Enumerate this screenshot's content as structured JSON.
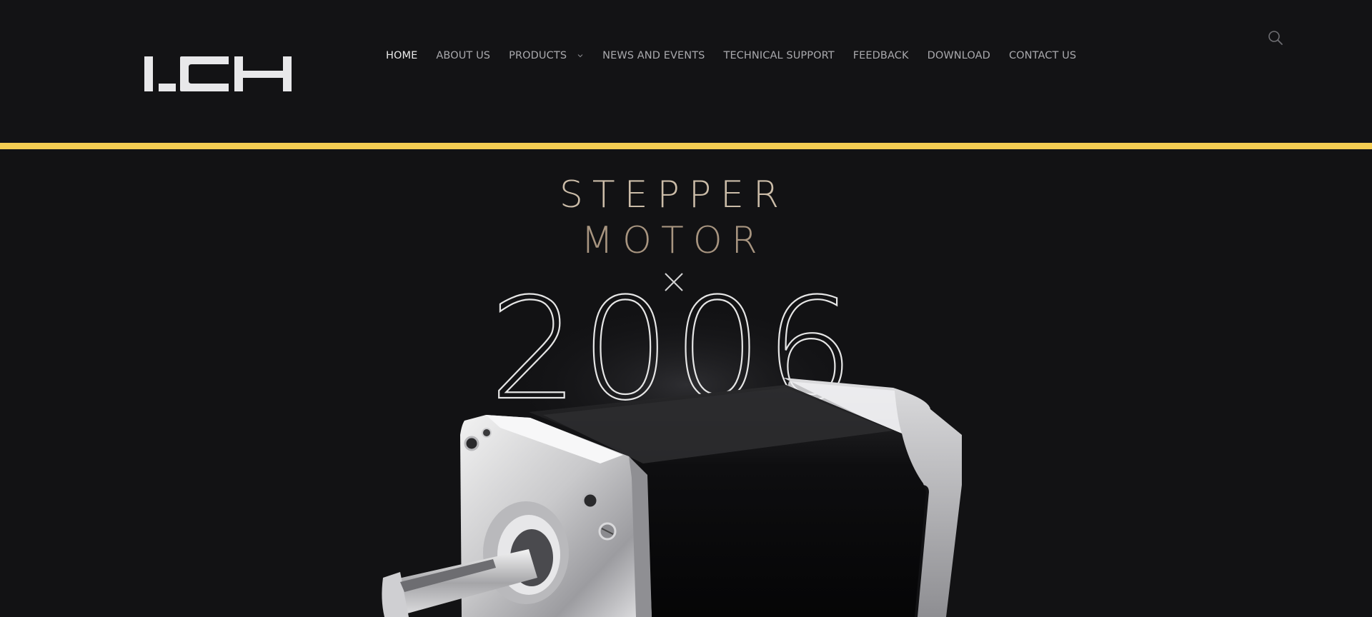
{
  "brand": {
    "logo_text": "I.CH"
  },
  "nav": {
    "items": [
      {
        "label": "HOME",
        "active": true
      },
      {
        "label": "ABOUT US"
      },
      {
        "label": "PRODUCTS",
        "has_dropdown": true
      },
      {
        "label": "NEWS AND EVENTS"
      },
      {
        "label": "TECHNICAL SUPPORT"
      },
      {
        "label": "FEEDBACK"
      },
      {
        "label": "DOWNLOAD"
      },
      {
        "label": "CONTACT US"
      }
    ],
    "dropdown_icon": "chevron-down-icon",
    "search_icon": "search-icon"
  },
  "hero": {
    "line1": "STEPPER",
    "line2": "MOTOR",
    "separator_icon": "close-icon",
    "year": "2006",
    "image": "stepper-motor-product"
  },
  "colors": {
    "background": "#121214",
    "accent_bar": "#f4cd52",
    "hero_text": "#b7a691",
    "nav_text": "#a9a9ad",
    "nav_active": "#ececec"
  }
}
